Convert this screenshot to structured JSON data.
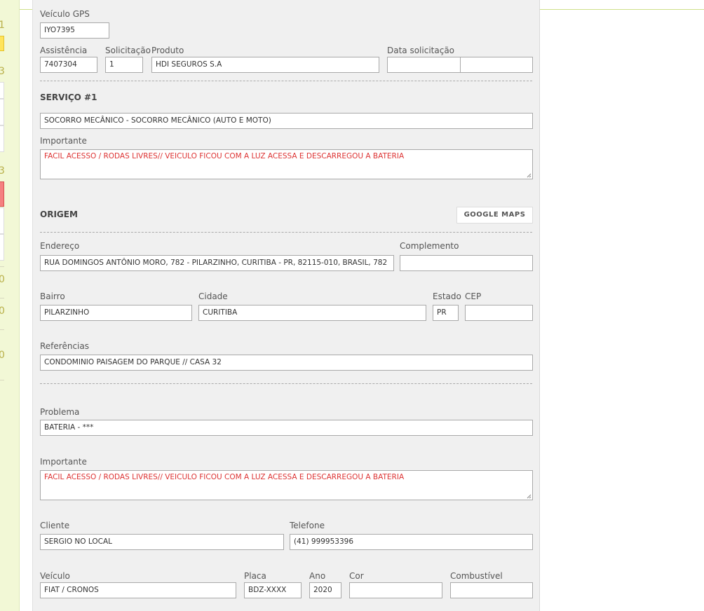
{
  "sidebar": {
    "numbers": [
      "1",
      "3",
      "3",
      "0",
      "0",
      "0"
    ]
  },
  "vehicle_gps": {
    "label": "Veículo GPS",
    "value": "IYO7395"
  },
  "assistance": {
    "assistencia_label": "Assistência",
    "assistencia_value": "7407304",
    "solicitacao_label": "Solicitação",
    "solicitacao_value": "1",
    "produto_label": "Produto",
    "produto_value": "HDI SEGUROS S.A",
    "data_label": "Data solicitação",
    "data_value": "",
    "hora_value": ""
  },
  "service": {
    "title": "SERVIÇO #1",
    "name_value": "SOCORRO MECÂNICO - SOCORRO MECÂNICO (AUTO E MOTO)",
    "importante_label": "Importante",
    "importante_value": "FACIL ACESSO / RODAS LIVRES// VEICULO FICOU COM A LUZ ACESSA E DESCARREGOU A BATERIA"
  },
  "origin": {
    "title": "ORIGEM",
    "maps_button": "GOOGLE MAPS",
    "endereco_label": "Endereço",
    "endereco_value": "RUA DOMINGOS ANTÔNIO MORO, 782 - PILARZINHO, CURITIBA - PR, 82115-010, BRASIL, 782",
    "complemento_label": "Complemento",
    "complemento_value": "",
    "bairro_label": "Bairro",
    "bairro_value": "PILARZINHO",
    "cidade_label": "Cidade",
    "cidade_value": "CURITIBA",
    "estado_label": "Estado",
    "estado_value": "PR",
    "cep_label": "CEP",
    "cep_value": "",
    "referencias_label": "Referências",
    "referencias_value": "CONDOMINIO PAISAGEM DO PARQUE // CASA 32"
  },
  "problem": {
    "problema_label": "Problema",
    "problema_value": "BATERIA - ***",
    "importante_label": "Importante",
    "importante_value": "FACIL ACESSO / RODAS LIVRES// VEICULO FICOU COM A LUZ ACESSA E DESCARREGOU A BATERIA"
  },
  "client": {
    "cliente_label": "Cliente",
    "cliente_value": "SERGIO NO LOCAL",
    "telefone_label": "Telefone",
    "telefone_value": "(41) 999953396"
  },
  "vehicle": {
    "veiculo_label": "Veículo",
    "veiculo_value": "FIAT / CRONOS",
    "placa_label": "Placa",
    "placa_value": "BDZ-XXXX",
    "ano_label": "Ano",
    "ano_value": "2020",
    "cor_label": "Cor",
    "cor_value": "",
    "combustivel_label": "Combustível",
    "combustivel_value": ""
  },
  "colors": {
    "important_text": "#dd3333",
    "panel_bg": "#f0f0f0",
    "sidebar_bg": "#f2f8d6",
    "highlight": "#ffe45a",
    "alert": "#f58080"
  }
}
